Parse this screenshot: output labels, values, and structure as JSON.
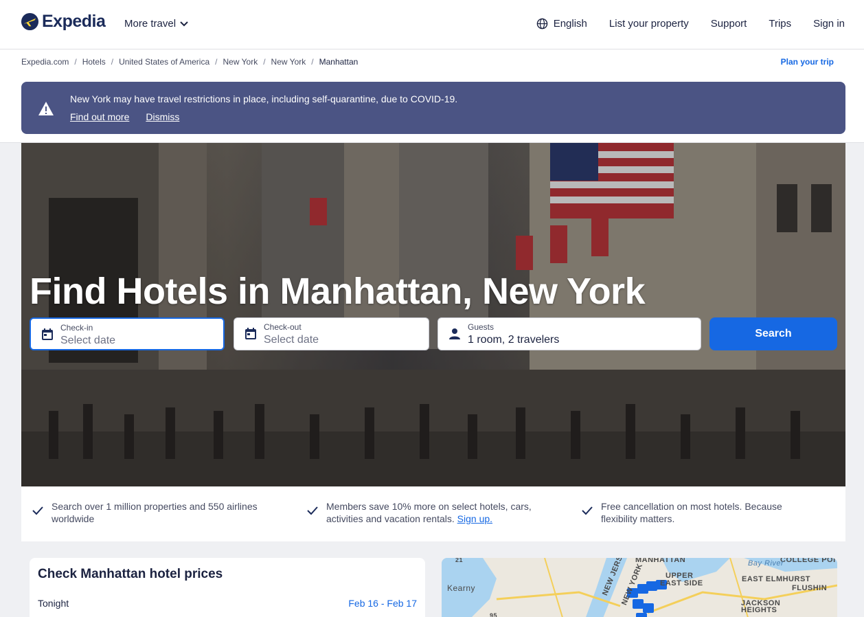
{
  "header": {
    "logo_text": "Expedia",
    "more_travel": "More travel",
    "nav": [
      "English",
      "List your property",
      "Support",
      "Trips",
      "Sign in"
    ]
  },
  "breadcrumb": {
    "items": [
      "Expedia.com",
      "Hotels",
      "United States of America",
      "New York",
      "New York",
      "Manhattan"
    ],
    "plan_trip": "Plan your trip"
  },
  "alert": {
    "message": "New York may have travel restrictions in place, including self-quarantine, due to COVID-19.",
    "find_out_more": "Find out more",
    "dismiss": "Dismiss"
  },
  "hero": {
    "title": "Find Hotels in Manhattan, New York",
    "checkin_label": "Check-in",
    "checkin_value": "Select date",
    "checkout_label": "Check-out",
    "checkout_value": "Select date",
    "guests_label": "Guests",
    "guests_value": "1 room, 2 travelers",
    "search_label": "Search"
  },
  "benefits": {
    "b1": "Search over 1 million properties and 550 airlines worldwide",
    "b2_text": "Members save 10% more on select hotels, cars, activities and vacation rentals.",
    "b2_link": "Sign up.",
    "b3": "Free cancellation on most hotels. Because flexibility matters."
  },
  "prices": {
    "title": "Check Manhattan hotel prices",
    "row_label": "Tonight",
    "row_dates": "Feb 16 - Feb 17"
  },
  "map": {
    "labels": [
      "MANHATTAN",
      "COLLEGE POI",
      "UPPER",
      "EAST SIDE",
      "EAST ELMHURST",
      "FLUSHIN",
      "Kearny",
      "JACKSON",
      "HEIGHTS",
      "NEW JERSEY",
      "NEW YORK",
      "Bay River",
      "21",
      "95"
    ]
  },
  "colors": {
    "brand_blue": "#1668e3",
    "alert_bg": "#4b5484",
    "navy": "#1b2b5a",
    "logo_yellow": "#fdd835"
  }
}
